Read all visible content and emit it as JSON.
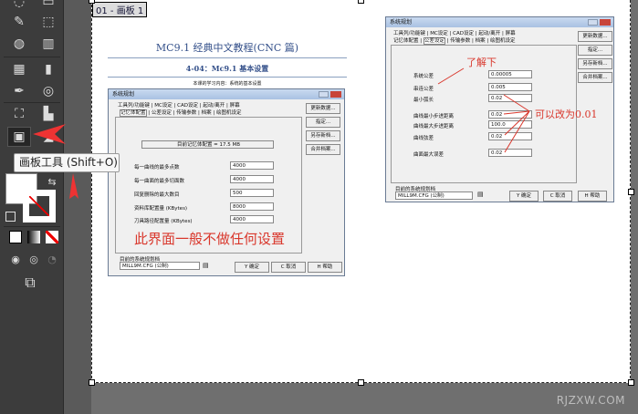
{
  "toolbar": {
    "tooltip": "画板工具 (Shift+O)",
    "selected_tool": "artboard-tool"
  },
  "artboard": {
    "label": "01 - 画板 1"
  },
  "watermark": "RJZXW.COM",
  "document": {
    "title": "MC9.1 经典中文教程(CNC 篇)",
    "subtitle": "4-04：Mc9.1 基本设置",
    "intro": "本课的学习内容：系统的基本设置"
  },
  "dialog_left": {
    "title": "系统规划",
    "tabs_row1": [
      "工具列/功能键",
      "MC设定",
      "CAD设定",
      "起动/离开",
      "屏幕"
    ],
    "tabs_row2": [
      "记忆体配置",
      "公差设定",
      "传输参数",
      "档案",
      "绘图机设定"
    ],
    "side_buttons": [
      "更新数据...",
      "指定...",
      "另存新档...",
      "合并档案..."
    ],
    "memory": "目前记忆体配置 = 17.5 MB",
    "fields": [
      {
        "label": "每一曲线的最多点数",
        "value": "4000"
      },
      {
        "label": "每一曲面的最多切面数",
        "value": "4000"
      },
      {
        "label": "回复删除的最大数目",
        "value": "500"
      },
      {
        "label": "资料库配置量 (KBytes)",
        "value": "8000"
      },
      {
        "label": "刀具路径配置量 (KBytes)",
        "value": "4000"
      }
    ],
    "note": "此界面一般不做任何设置",
    "config_label": "目前的系统规划档",
    "config_value": "MILL9M.CFG (公制)",
    "buttons": [
      "Y 确定",
      "C 取消",
      "H 帮助"
    ]
  },
  "dialog_right": {
    "title": "系统规划",
    "tabs_row1": [
      "工具列/功能键",
      "MC设定",
      "CAD设定",
      "起动/离开",
      "屏幕"
    ],
    "tabs_row2": [
      "记忆体配置",
      "公差设定",
      "传输参数",
      "档案",
      "绘图机设定"
    ],
    "side_buttons": [
      "更新数据...",
      "指定...",
      "另存新档...",
      "合并档案..."
    ],
    "fields": [
      {
        "label": "系统公差",
        "value": "0.00005"
      },
      {
        "label": "串连公差",
        "value": "0.005"
      },
      {
        "label": "最小弧长",
        "value": "0.02"
      },
      {
        "label": "曲线最小步进距离",
        "value": "0.02"
      },
      {
        "label": "曲线最大步进距离",
        "value": "100.0"
      },
      {
        "label": "曲线弦差",
        "value": "0.02"
      },
      {
        "label": "曲面最大误差",
        "value": "0.02"
      }
    ],
    "note1": "了解下",
    "note2": "可以改为0.01",
    "config_label": "目前的系统规划档",
    "config_value": "MILL9M.CFG (公制)",
    "buttons": [
      "Y 确定",
      "C 取消",
      "H 帮助"
    ]
  }
}
